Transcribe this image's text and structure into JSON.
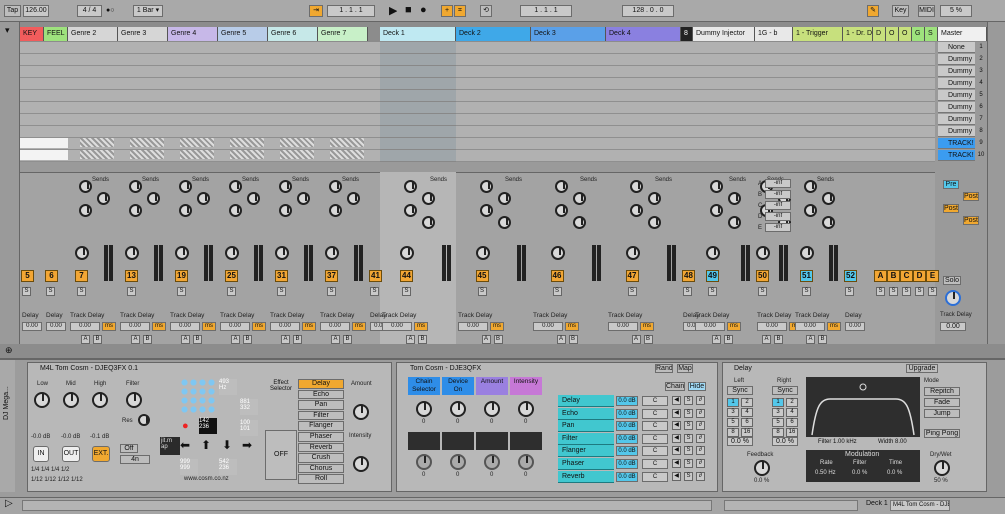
{
  "transport": {
    "tap": "Tap",
    "tempo": "126.00",
    "meter": "4 / 4",
    "metro": "●○",
    "quant": "1 Bar ▾",
    "pos": "1 .   1 .   1",
    "pos2": "1 .   1 .   1",
    "loop": "128 .   0 .   0",
    "key": "Key",
    "midi": "MIDI",
    "cpu": "5 %"
  },
  "tracks": [
    {
      "name": "KEY",
      "color": "#f25c5c"
    },
    {
      "name": "FEEL",
      "color": "#9ee27d"
    },
    {
      "name": "Genre 2",
      "color": "#d6d6d6"
    },
    {
      "name": "Genre 3",
      "color": "#d6d6d6"
    },
    {
      "name": "Genre 4",
      "color": "#c7b8e8"
    },
    {
      "name": "Genre 5",
      "color": "#b8cce8"
    },
    {
      "name": "Genre 6",
      "color": "#c6e8e8"
    },
    {
      "name": "Genre 7",
      "color": "#c8f0c8"
    },
    {
      "name": "Deck 1",
      "color": "#bfe9f2"
    },
    {
      "name": "Deck 2",
      "color": "#3fa8e8"
    },
    {
      "name": "Deck 3",
      "color": "#5aa0e8"
    },
    {
      "name": "Deck 4",
      "color": "#8a80e0"
    },
    {
      "name": "8",
      "color": "#222"
    },
    {
      "name": "Dummy Injector",
      "color": "#e8e8e8"
    },
    {
      "name": "1G - b",
      "color": "#e8e8e8"
    },
    {
      "name": "1 - Trigger",
      "color": "#c7e07d"
    },
    {
      "name": "1 - Dr. Dr",
      "color": "#c7e07d"
    },
    {
      "name": "D",
      "color": "#c7e07d"
    },
    {
      "name": "O",
      "color": "#c7e07d"
    },
    {
      "name": "O",
      "color": "#c7e07d"
    },
    {
      "name": "G",
      "color": "#9ee27d"
    },
    {
      "name": "S",
      "color": "#9ee27d"
    },
    {
      "name": "Master",
      "color": "#f0f0f0"
    }
  ],
  "scenes": [
    "None",
    "Dummy",
    "Dummy",
    "Dummy",
    "Dummy",
    "Dummy",
    "Dummy",
    "Dummy",
    "TRACK!",
    "TRACK!"
  ],
  "scene_nums": [
    "1",
    "2",
    "3",
    "4",
    "5",
    "6",
    "7",
    "8",
    "9",
    "10"
  ],
  "mixer": {
    "nums": [
      "5",
      "6",
      "7",
      "13",
      "19",
      "25",
      "31",
      "37",
      "41",
      "44",
      "45",
      "46",
      "47",
      "48",
      "49",
      "50",
      "51",
      "52"
    ],
    "letters": [
      "A",
      "B",
      "C",
      "D",
      "E"
    ],
    "sends": "Sends",
    "inf": "-inf",
    "post": "Post",
    "pre": "Pre",
    "solo": "Solo",
    "delay_label": "Track Delay",
    "delay_short": "Delay",
    "delay_val": "0.00",
    "ms": "ms",
    "ab": [
      "A",
      "B"
    ]
  },
  "device1": {
    "title": "M4L Tom Cosm - DJEQ3FX 0.1",
    "low": "Low",
    "mid": "Mid",
    "high": "High",
    "filter": "Filter",
    "res": "Res",
    "db1": "-0.0 dB",
    "db2": "-0.0 dB",
    "db3": "-0.1 dB",
    "in": "IN",
    "out": "OUT",
    "ext": "EXT.",
    "off": "Off",
    "mode": "4n",
    "side": "DJ Mega...",
    "r1": "1/4 1/4 1/4 1/2",
    "r2": "1/12 1/12 1/12 1/12",
    "url": "www.cosm.co.nz",
    "n1": "142\n236",
    "n2": "999\n999",
    "n3": "493\nHz",
    "n4": "881\n332",
    "n5": "100\n101",
    "n6": "542\n236",
    "jit": "jit.m\nap",
    "effect_sel": "Effect\nSelector",
    "amount": "Amount",
    "intensity": "Intensity",
    "off2": "OFF",
    "effects": [
      "Delay",
      "Echo",
      "Pan",
      "Filter",
      "Flanger",
      "Phaser",
      "Reverb",
      "Crush",
      "Chorus",
      "Roll"
    ]
  },
  "device2": {
    "title": "Tom Cosm - DJE3QFX",
    "rand": "Rand",
    "map": "Map",
    "chain": "Chain",
    "hide": "Hide",
    "macros": [
      "Chain\nSelector",
      "Device\nOn",
      "Amount",
      "Intensity"
    ],
    "mval": "0",
    "chains": [
      "Delay",
      "Echo",
      "Pan",
      "Filter",
      "Flanger",
      "Phaser",
      "Reverb"
    ],
    "db": "0.0 dB",
    "c": "C"
  },
  "delay": {
    "title": "Delay",
    "upgrade": "Upgrade",
    "left": "Left",
    "right": "Right",
    "sync": "Sync",
    "grid": [
      "1",
      "2",
      "3",
      "4",
      "5",
      "6",
      "8",
      "16"
    ],
    "pct": "0.0 %",
    "feedback": "Feedback",
    "fb_val": "0.0 %",
    "filter": "Filter 1.00 kHz",
    "width": "Width 8.00",
    "modulation": "Modulation",
    "rate": "Rate",
    "rate_val": "0.50 Hz",
    "filt": "Filter",
    "filt_val": "0.0 %",
    "time": "Time",
    "time_val": "0.0 %",
    "mode": "Mode",
    "repitch": "Repitch",
    "fade": "Fade",
    "jump": "Jump",
    "pingpong": "Ping Pong",
    "drywet": "Dry/Wet",
    "dw_val": "50 %"
  },
  "status": {
    "deck": "Deck 1",
    "device": "M4L Tom Cosm - DJE"
  }
}
